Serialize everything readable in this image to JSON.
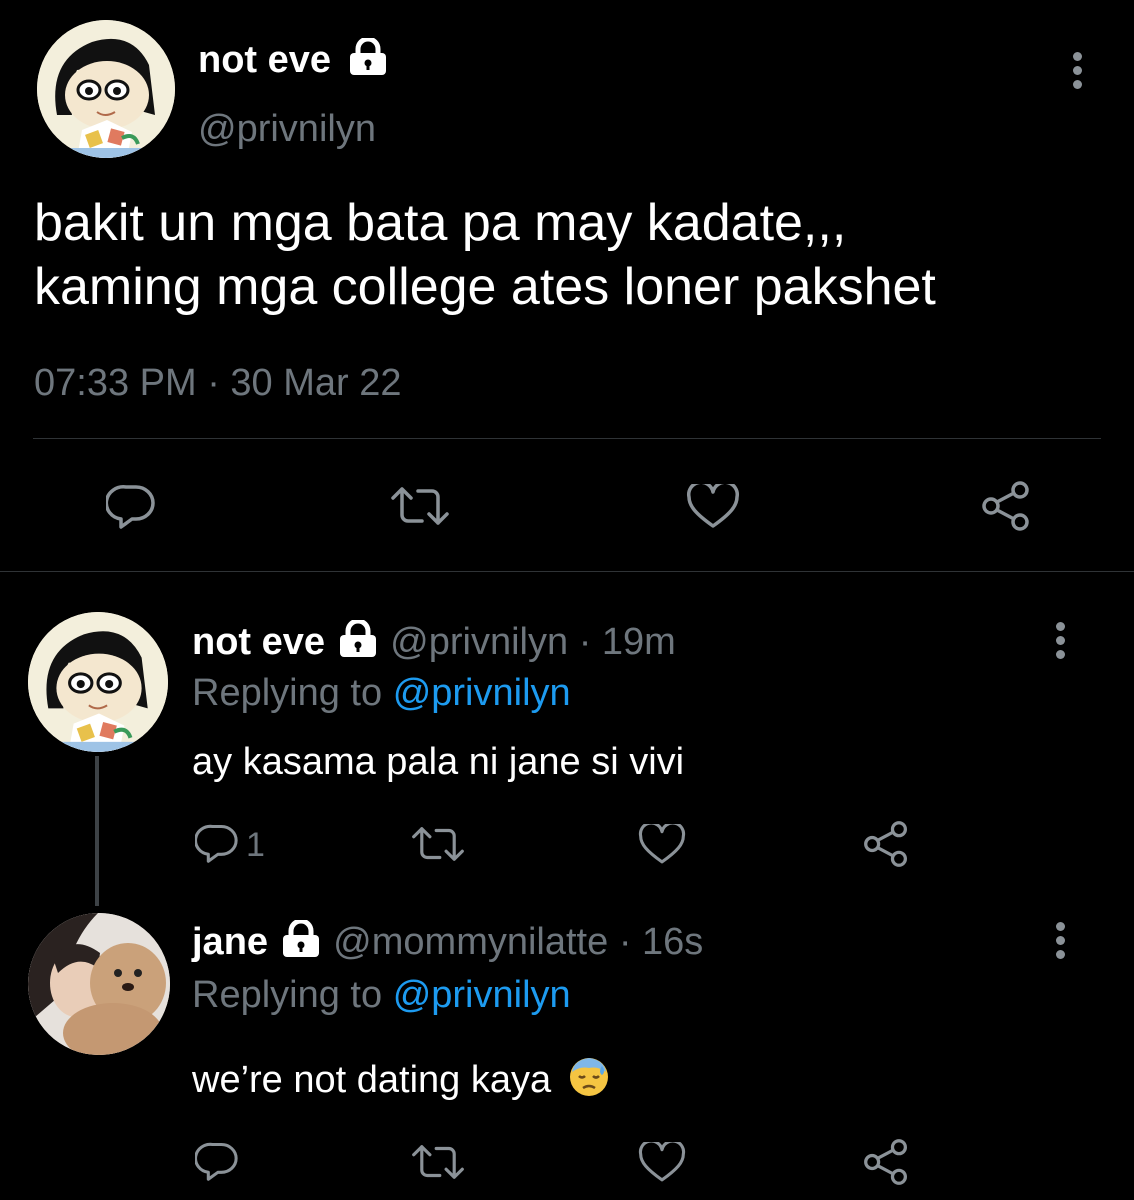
{
  "main_tweet": {
    "display_name": "not eve",
    "handle": "@privnilyn",
    "text_line1": "bakit un mga bata pa may kadate,,,",
    "text_line2": "kaming mga college ates loner pakshet",
    "timestamp": "07:33 PM · 30 Mar 22"
  },
  "replies": [
    {
      "display_name": "not eve",
      "handle": "@privnilyn",
      "time": "· 19m",
      "replying_prefix": "Replying to",
      "replying_to": "@privnilyn",
      "text": "ay kasama pala ni jane si vivi",
      "reply_count": "1"
    },
    {
      "display_name": "jane",
      "handle": "@mommynilatte",
      "time": "· 16s",
      "replying_prefix": "Replying to",
      "replying_to": "@privnilyn",
      "text": "we’re not dating kaya",
      "emoji": "downcast-face-with-sweat"
    }
  ],
  "icons": [
    "comment-icon",
    "retweet-icon",
    "like-icon",
    "share-icon",
    "lock-icon",
    "more-icon"
  ],
  "colors": {
    "background": "#000000",
    "link": "#1d9bf0",
    "muted": "#6e767d",
    "divider": "#2f3336"
  }
}
